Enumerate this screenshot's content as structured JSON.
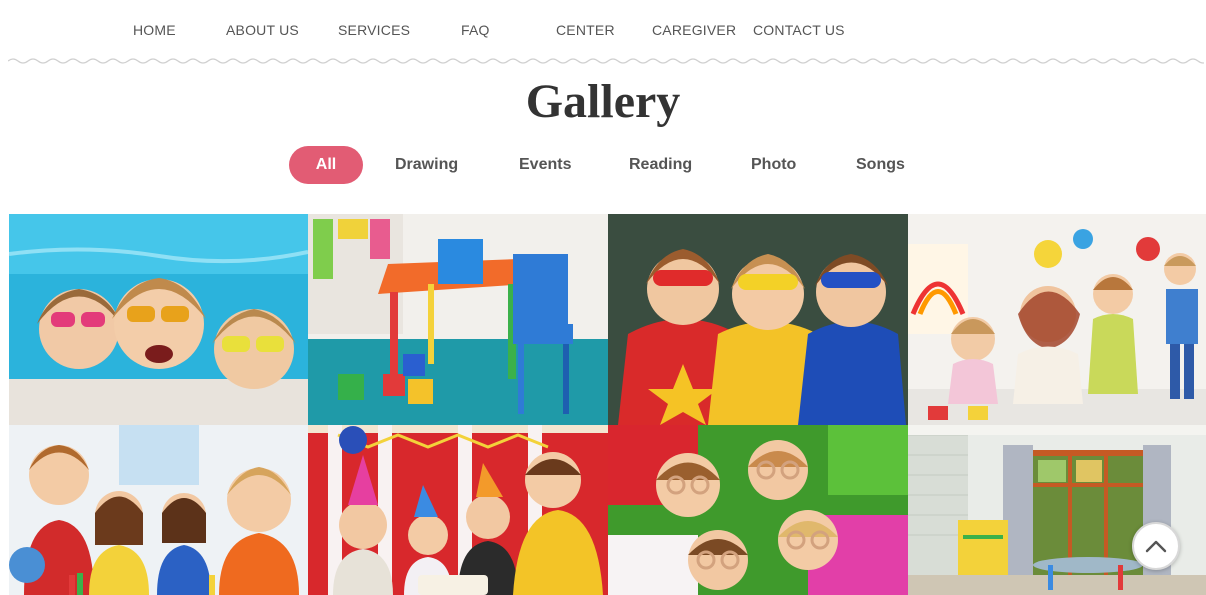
{
  "nav": {
    "items": [
      {
        "label": "HOME"
      },
      {
        "label": "ABOUT US"
      },
      {
        "label": "SERVICES"
      },
      {
        "label": "FAQ"
      },
      {
        "label": "CENTER"
      },
      {
        "label": "CAREGIVER"
      },
      {
        "label": "CONTACT US"
      }
    ]
  },
  "gallery": {
    "title": "Gallery",
    "filters": [
      {
        "label": "All",
        "active": true
      },
      {
        "label": "Drawing",
        "active": false
      },
      {
        "label": "Events",
        "active": false
      },
      {
        "label": "Reading",
        "active": false
      },
      {
        "label": "Photo",
        "active": false
      },
      {
        "label": "Songs",
        "active": false
      }
    ],
    "images": [
      {
        "subject": "three girls with sunglasses in a swimming pool"
      },
      {
        "subject": "colorful kids table and chairs with toy blocks"
      },
      {
        "subject": "three kids in superhero masks and capes"
      },
      {
        "subject": "teacher with children painting in art class"
      },
      {
        "subject": "children smiling at classroom desk"
      },
      {
        "subject": "kids at a birthday party with party hats"
      },
      {
        "subject": "children lying on grass making binocular hands"
      },
      {
        "subject": "empty bright playroom with large windows"
      }
    ]
  },
  "colors": {
    "accent": "#e25c74",
    "nav_text": "#555555",
    "title_text": "#333333"
  },
  "icons": {
    "scroll_top": "chevron-up-icon"
  }
}
